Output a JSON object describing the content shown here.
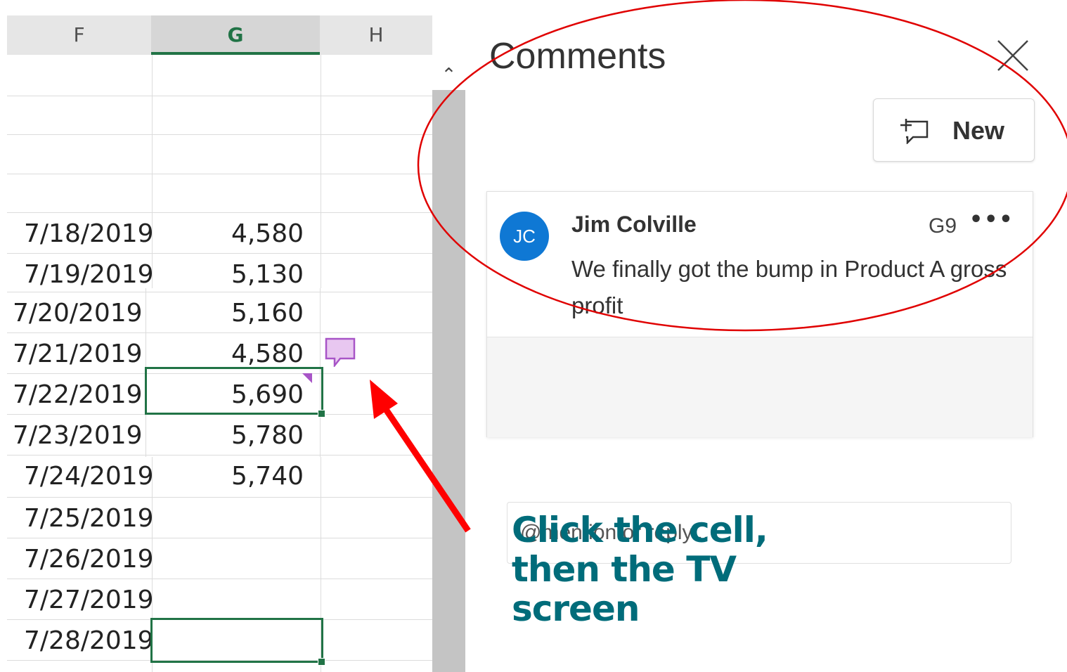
{
  "sheet": {
    "columns": [
      "F",
      "G",
      "H"
    ],
    "selected_column": "G",
    "rows": [
      {
        "date": "",
        "value": ""
      },
      {
        "date": "",
        "value": ""
      },
      {
        "date": "",
        "value": ""
      },
      {
        "date": "",
        "value": ""
      },
      {
        "date": "7/18/2019",
        "value": "4,580"
      },
      {
        "date": "7/19/2019",
        "value": "5,130"
      },
      {
        "date": "7/20/2019",
        "value": "5,160"
      },
      {
        "date": "7/21/2019",
        "value": "4,580"
      },
      {
        "date": "7/22/2019",
        "value": "5,690"
      },
      {
        "date": "7/23/2019",
        "value": "5,780"
      },
      {
        "date": "7/24/2019",
        "value": "5,740"
      },
      {
        "date": "7/25/2019",
        "value": ""
      },
      {
        "date": "7/26/2019",
        "value": ""
      },
      {
        "date": "7/27/2019",
        "value": ""
      },
      {
        "date": "7/28/2019",
        "value": ""
      }
    ],
    "scroll_up_icon": "chevron-up-icon",
    "comment_indicator_icon": "comment-bubble-icon",
    "comment_color": "#a855c7",
    "selection_color": "#217346"
  },
  "comments_pane": {
    "title": "Comments",
    "close_icon": "close-icon",
    "new_button_label": "New",
    "new_icon": "new-comment-icon",
    "comment": {
      "avatar_initials": "JC",
      "avatar_color": "#0f78d4",
      "author": "Jim Colville",
      "cell_ref": "G9",
      "more_label": "•••",
      "text": "We finally got the bump in Product A gross profit"
    },
    "reply_placeholder": "@mention or reply..."
  },
  "annotation": {
    "callout_line1": "Click the cell,",
    "callout_line2": "then the TV",
    "callout_line3": "screen",
    "callout_color": "#006c7a",
    "arrow_color": "#ff0000",
    "ellipse_color": "#e00000"
  }
}
